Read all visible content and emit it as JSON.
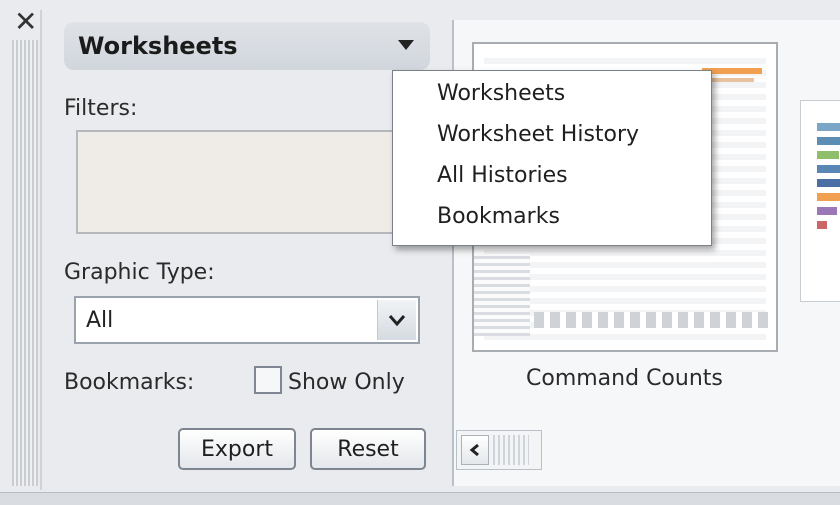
{
  "panel": {
    "close_glyph": "✕",
    "header_title": "Worksheets",
    "filters_label": "Filters:",
    "graphic_type_label": "Graphic Type:",
    "graphic_type_value": "All",
    "bookmarks_label": "Bookmarks:",
    "show_only_label": "Show Only",
    "show_only_checked": false,
    "export_label": "Export",
    "reset_label": "Reset"
  },
  "dropdown_menu": {
    "items": [
      "Worksheets",
      "Worksheet History",
      "All Histories",
      "Bookmarks"
    ]
  },
  "thumbnails": [
    {
      "caption": "Command Counts"
    }
  ],
  "icons": {
    "close": "close-icon",
    "header_dropdown": "chevron-down-icon",
    "select_dropdown": "chevron-down-icon",
    "scroll_left": "chevron-left-icon"
  },
  "colors": {
    "header_bg": "#d6dbe1",
    "filters_bg": "#efebe6",
    "accent_orange": "#f0a050"
  }
}
